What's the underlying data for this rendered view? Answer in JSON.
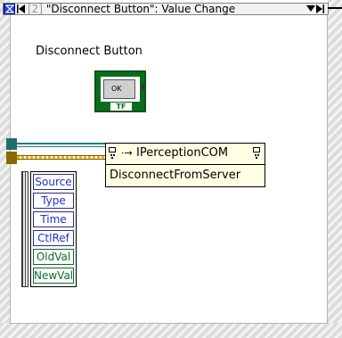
{
  "case_selector": {
    "index_label": "[2]",
    "event_label": "\"Disconnect Button\": Value Change"
  },
  "control": {
    "label": "Disconnect Button",
    "button_text": "OK",
    "type_badge": "TF"
  },
  "invoke_node": {
    "class_name": "IPerceptionCOM",
    "method_name": "DisconnectFromServer",
    "arrow": "·→"
  },
  "event_data": {
    "items": [
      "Source",
      "Type",
      "Time",
      "CtlRef",
      "OldVal",
      "NewVal"
    ]
  },
  "colors": {
    "selector_accent": "#1e3fd9",
    "boolean_green": "#0b6c1f",
    "refnum_teal": "#1e6d70",
    "error_gold": "#e8b800",
    "node_fill": "#ffffe3"
  }
}
